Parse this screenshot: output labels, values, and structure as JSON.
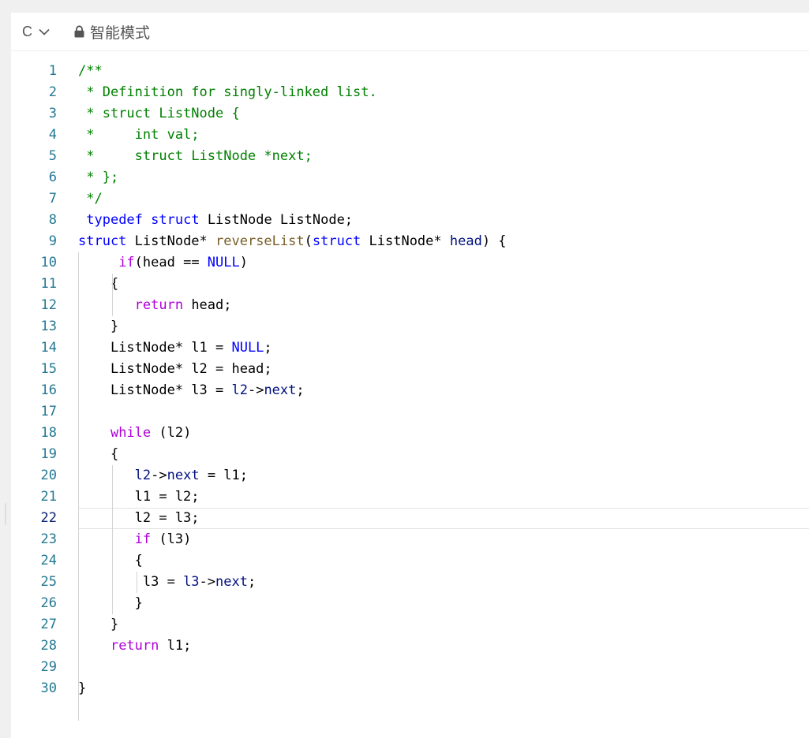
{
  "toolbar": {
    "language": "C",
    "language_icon": "chevron-down-icon",
    "mode_label": "智能模式",
    "mode_icon": "lock-icon"
  },
  "editor": {
    "current_line": 22,
    "lines": [
      {
        "n": "1",
        "tokens": [
          {
            "t": "/**",
            "k": "c"
          }
        ]
      },
      {
        "n": "2",
        "tokens": [
          {
            "t": " * Definition for singly-linked list.",
            "k": "c"
          }
        ]
      },
      {
        "n": "3",
        "tokens": [
          {
            "t": " * struct ListNode {",
            "k": "c"
          }
        ]
      },
      {
        "n": "4",
        "tokens": [
          {
            "t": " *     int val;",
            "k": "c"
          }
        ]
      },
      {
        "n": "5",
        "tokens": [
          {
            "t": " *     struct ListNode *next;",
            "k": "c"
          }
        ]
      },
      {
        "n": "6",
        "tokens": [
          {
            "t": " * };",
            "k": "c"
          }
        ]
      },
      {
        "n": "7",
        "tokens": [
          {
            "t": " */",
            "k": "c"
          }
        ]
      },
      {
        "n": "8",
        "tokens": [
          {
            "t": " "
          },
          {
            "t": "typedef",
            "k": "k"
          },
          {
            "t": " "
          },
          {
            "t": "struct",
            "k": "k"
          },
          {
            "t": " ListNode ListNode;"
          }
        ]
      },
      {
        "n": "9",
        "tokens": [
          {
            "t": "struct",
            "k": "k"
          },
          {
            "t": " ListNode* "
          },
          {
            "t": "reverseList",
            "k": "f"
          },
          {
            "t": "("
          },
          {
            "t": "struct",
            "k": "k"
          },
          {
            "t": " ListNode* "
          },
          {
            "t": "head",
            "k": "p"
          },
          {
            "t": ") {"
          }
        ]
      },
      {
        "n": "10",
        "tokens": [
          {
            "t": "     "
          },
          {
            "t": "if",
            "k": "x"
          },
          {
            "t": "(head == "
          },
          {
            "t": "NULL",
            "k": "k"
          },
          {
            "t": ")"
          }
        ]
      },
      {
        "n": "11",
        "tokens": [
          {
            "t": "    {"
          }
        ]
      },
      {
        "n": "12",
        "tokens": [
          {
            "t": "       "
          },
          {
            "t": "return",
            "k": "x"
          },
          {
            "t": " head;"
          }
        ]
      },
      {
        "n": "13",
        "tokens": [
          {
            "t": "    }"
          }
        ]
      },
      {
        "n": "14",
        "tokens": [
          {
            "t": "    ListNode* l1 = "
          },
          {
            "t": "NULL",
            "k": "k"
          },
          {
            "t": ";"
          }
        ]
      },
      {
        "n": "15",
        "tokens": [
          {
            "t": "    ListNode* l2 = head;"
          }
        ]
      },
      {
        "n": "16",
        "tokens": [
          {
            "t": "    ListNode* l3 = "
          },
          {
            "t": "l2",
            "k": "p"
          },
          {
            "t": "->"
          },
          {
            "t": "next",
            "k": "p"
          },
          {
            "t": ";"
          }
        ]
      },
      {
        "n": "17",
        "tokens": []
      },
      {
        "n": "18",
        "tokens": [
          {
            "t": "    "
          },
          {
            "t": "while",
            "k": "x"
          },
          {
            "t": " (l2)"
          }
        ]
      },
      {
        "n": "19",
        "tokens": [
          {
            "t": "    {"
          }
        ]
      },
      {
        "n": "20",
        "tokens": [
          {
            "t": "       "
          },
          {
            "t": "l2",
            "k": "p"
          },
          {
            "t": "->"
          },
          {
            "t": "next",
            "k": "p"
          },
          {
            "t": " = l1;"
          }
        ]
      },
      {
        "n": "21",
        "tokens": [
          {
            "t": "       l1 = l2;"
          }
        ]
      },
      {
        "n": "22",
        "tokens": [
          {
            "t": "       l2 = l3;"
          }
        ]
      },
      {
        "n": "23",
        "tokens": [
          {
            "t": "       "
          },
          {
            "t": "if",
            "k": "x"
          },
          {
            "t": " (l3)"
          }
        ]
      },
      {
        "n": "24",
        "tokens": [
          {
            "t": "       {"
          }
        ]
      },
      {
        "n": "25",
        "tokens": [
          {
            "t": "        l3 = "
          },
          {
            "t": "l3",
            "k": "p"
          },
          {
            "t": "->"
          },
          {
            "t": "next",
            "k": "p"
          },
          {
            "t": ";"
          }
        ]
      },
      {
        "n": "26",
        "tokens": [
          {
            "t": "       }"
          }
        ]
      },
      {
        "n": "27",
        "tokens": [
          {
            "t": "    }"
          }
        ]
      },
      {
        "n": "28",
        "tokens": [
          {
            "t": "    "
          },
          {
            "t": "return",
            "k": "x"
          },
          {
            "t": " l1;"
          }
        ]
      },
      {
        "n": "29",
        "tokens": []
      },
      {
        "n": "30",
        "tokens": [
          {
            "t": "}"
          }
        ]
      }
    ]
  },
  "colors": {
    "comment": "#008000",
    "keyword": "#0000ff",
    "control": "#af00db",
    "function": "#795e26",
    "identifier": "#001080",
    "line_number": "#237893"
  }
}
